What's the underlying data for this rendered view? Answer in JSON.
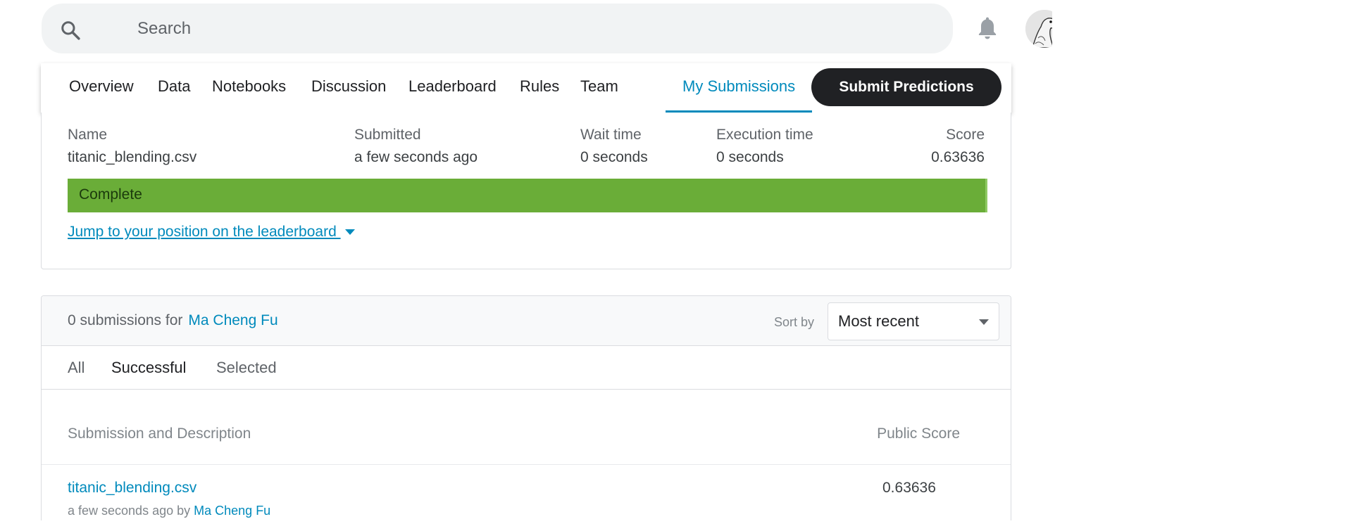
{
  "search": {
    "placeholder": "Search"
  },
  "tabs": [
    {
      "label": "Overview"
    },
    {
      "label": "Data"
    },
    {
      "label": "Notebooks"
    },
    {
      "label": "Discussion"
    },
    {
      "label": "Leaderboard"
    },
    {
      "label": "Rules"
    },
    {
      "label": "Team"
    },
    {
      "label": "My Submissions"
    }
  ],
  "active_tab": "My Submissions",
  "submit_label": "Submit Predictions",
  "result": {
    "headers": {
      "name": "Name",
      "submitted": "Submitted",
      "wait": "Wait time",
      "exec": "Execution time",
      "score": "Score"
    },
    "values": {
      "name": "titanic_blending.csv",
      "submitted": "a few seconds ago",
      "wait": "0 seconds",
      "exec": "0 seconds",
      "score": "0.63636"
    },
    "status": "Complete",
    "jump_link": "Jump to your position on the leaderboard "
  },
  "submissions": {
    "count_text": "0 submissions for",
    "user": "Ma Cheng Fu",
    "sort_label": "Sort by",
    "sort_value": "Most recent",
    "filters": [
      "All",
      "Successful",
      "Selected"
    ],
    "active_filter": "Successful",
    "columns": {
      "description": "Submission and Description",
      "public_score": "Public Score"
    },
    "rows": [
      {
        "file": "titanic_blending.csv",
        "when": "a few seconds ago by",
        "by": "Ma Cheng Fu",
        "score": "0.63636"
      }
    ]
  },
  "colors": {
    "accent": "#008abc",
    "complete": "#6aad38",
    "button": "#202124"
  },
  "icons": {
    "search": "search-icon",
    "notifications": "bell-icon",
    "avatar": "goose-avatar"
  }
}
